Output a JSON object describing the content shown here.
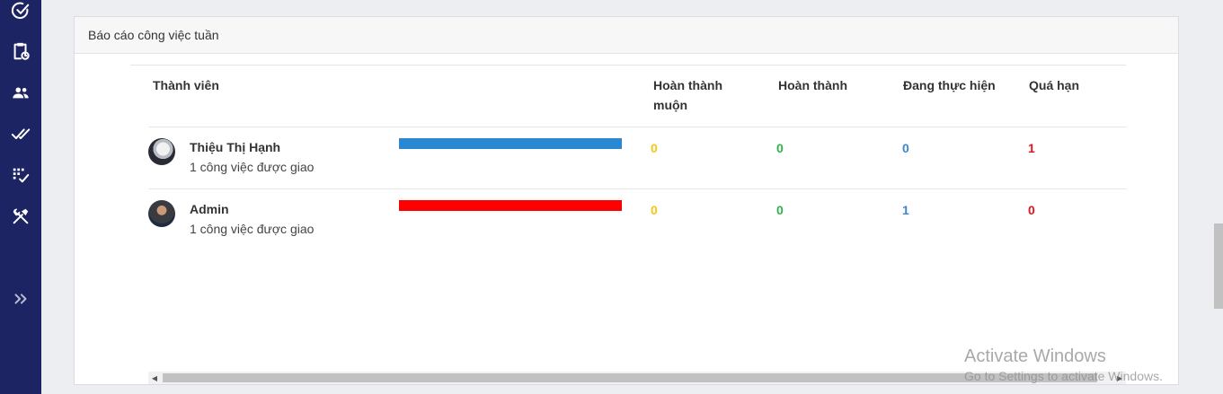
{
  "sidebar": {
    "items": [
      {
        "icon": "check-circle-icon"
      },
      {
        "icon": "clipboard-clock-icon"
      },
      {
        "icon": "users-icon"
      },
      {
        "icon": "double-check-icon"
      },
      {
        "icon": "grid-check-icon"
      },
      {
        "icon": "tools-icon"
      }
    ],
    "expand_icon": "double-chevron-right-icon"
  },
  "card": {
    "title": "Báo cáo công việc tuần",
    "columns": {
      "member": "Thành viên",
      "late_done_line1": "Hoàn thành",
      "late_done_line2": "muộn",
      "done": "Hoàn thành",
      "in_progress": "Đang thực hiện",
      "overdue": "Quá hạn"
    },
    "rows": [
      {
        "name": "Thiệu Thị Hạnh",
        "tasks": "1 công việc được giao",
        "bar_color": "#2b87d1",
        "late_done": "0",
        "done": "0",
        "in_progress": "0",
        "overdue": "1"
      },
      {
        "name": "Admin",
        "tasks": "1 công việc được giao",
        "bar_color": "#ff0000",
        "late_done": "0",
        "done": "0",
        "in_progress": "1",
        "overdue": "0"
      }
    ]
  },
  "colors": {
    "sidebar_bg": "#1c2463",
    "late_done": "#f5c518",
    "done": "#2db34a",
    "in_progress": "#3a86d0",
    "overdue": "#e0141c"
  },
  "watermark": {
    "title": "Activate Windows",
    "subtitle": "Go to Settings to activate Windows."
  }
}
